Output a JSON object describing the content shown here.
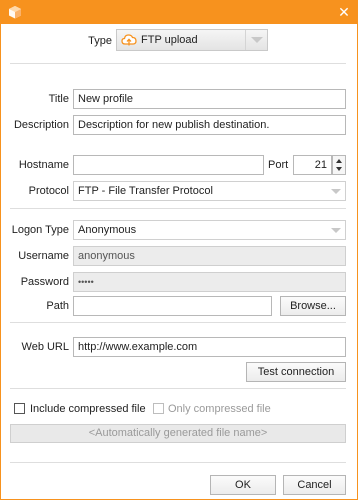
{
  "window": {
    "close_glyph": "✕",
    "title_color": "#f7921e",
    "app_icon": "box-logo-icon"
  },
  "type": {
    "label": "Type",
    "value": "FTP upload",
    "icon": "cloud-upload-icon"
  },
  "profile": {
    "title_label": "Title",
    "title_value": "New profile",
    "description_label": "Description",
    "description_value": "Description for new publish destination."
  },
  "connection": {
    "hostname_label": "Hostname",
    "hostname_value": "",
    "port_label": "Port",
    "port_value": "21",
    "protocol_label": "Protocol",
    "protocol_value": "FTP - File Transfer Protocol"
  },
  "logon": {
    "logon_type_label": "Logon Type",
    "logon_type_value": "Anonymous",
    "username_label": "Username",
    "username_value": "anonymous",
    "password_label": "Password",
    "password_value": "•••••",
    "path_label": "Path",
    "path_value": "",
    "browse_label": "Browse..."
  },
  "web": {
    "url_label": "Web URL",
    "url_value": "http://www.example.com",
    "test_label": "Test connection"
  },
  "options": {
    "include_compressed_label": "Include compressed file",
    "include_compressed_checked": false,
    "only_compressed_label": "Only compressed file",
    "only_compressed_checked": false,
    "autogen_filename": "<Automatically generated file name>"
  },
  "footer": {
    "ok_label": "OK",
    "cancel_label": "Cancel"
  }
}
